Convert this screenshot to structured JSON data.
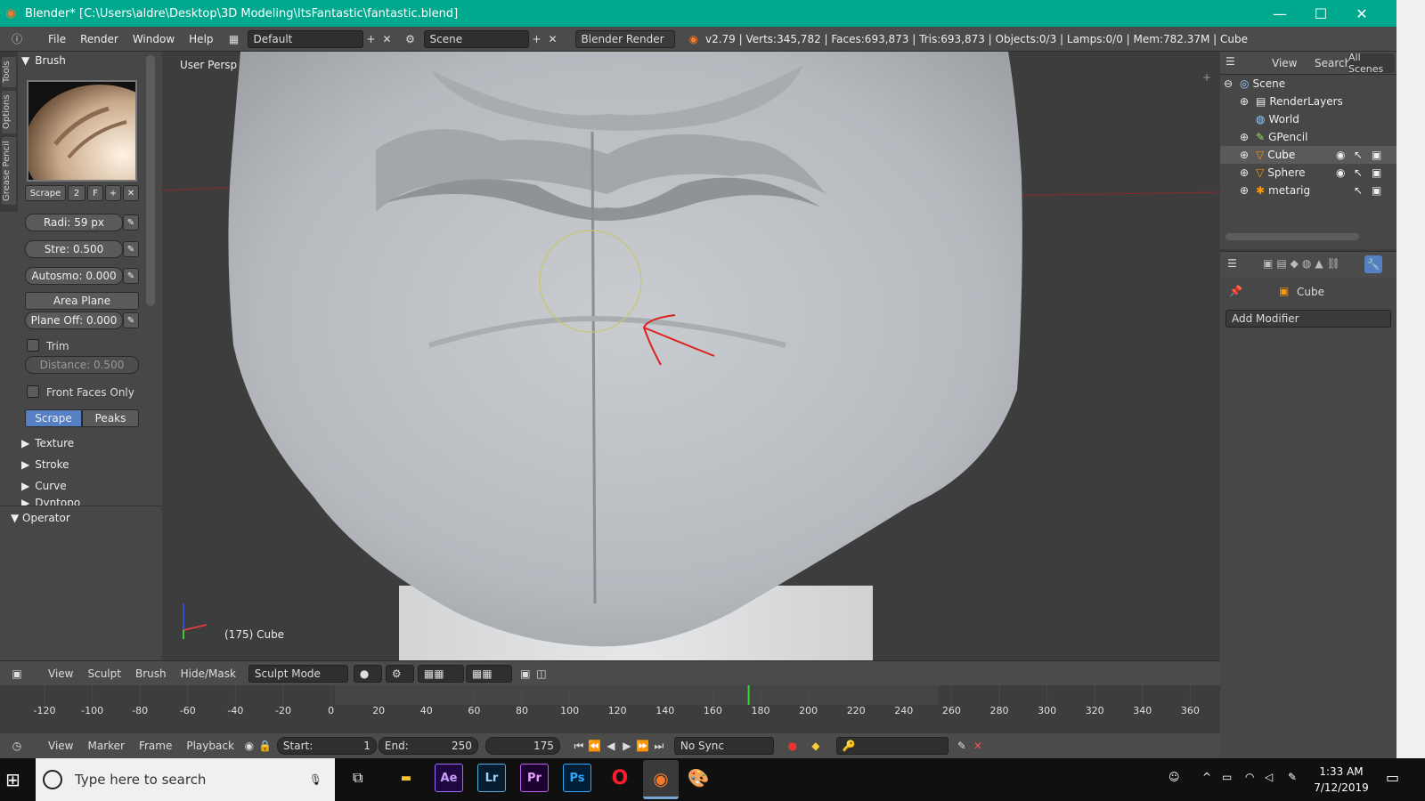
{
  "window": {
    "title": "Blender* [C:\\Users\\aldre\\Desktop\\3D Modeling\\ItsFantastic\\fantastic.blend]",
    "minimize": "—",
    "maximize": "☐",
    "close": "✕"
  },
  "menubar": {
    "items": [
      "File",
      "Render",
      "Window",
      "Help"
    ],
    "layout": "Default",
    "scene": "Scene",
    "engine": "Blender Render",
    "stats": "v2.79 | Verts:345,782 | Faces:693,873 | Tris:693,873 | Objects:0/3 | Lamps:0/0 | Mem:782.37M | Cube"
  },
  "tool_tabs": [
    "Tools",
    "Options",
    "Grease Pencil"
  ],
  "brush_panel": {
    "header": "Brush",
    "brush_name": "Scrape",
    "users": "2",
    "fake_user": "F",
    "radius_label": "Radi:",
    "radius_value": "59 px",
    "strength_label": "Stre:",
    "strength_value": "0.500",
    "autosmooth_label": "Autosmo:",
    "autosmooth_value": "0.000",
    "area_plane": "Area Plane",
    "plane_offset_label": "Plane Off:",
    "plane_offset_value": "0.000",
    "trim_label": "Trim",
    "trim_checked": false,
    "distance_label": "Distance:",
    "distance_value": "0.500",
    "front_faces_label": "Front Faces Only",
    "front_faces_checked": false,
    "mode_scrape": "Scrape",
    "mode_peaks": "Peaks",
    "active_mode": "Scrape",
    "collapsed": [
      "Texture",
      "Stroke",
      "Curve",
      "Dyntopo"
    ]
  },
  "operator_panel": {
    "header": "Operator"
  },
  "viewport": {
    "view_name": "User Persp",
    "object_info": "(175) Cube"
  },
  "outliner": {
    "view_label": "View",
    "search_label": "Search",
    "scenes_label": "All Scenes",
    "rows": [
      {
        "name": "Scene",
        "indent": 0
      },
      {
        "name": "RenderLayers",
        "indent": 1
      },
      {
        "name": "World",
        "indent": 1
      },
      {
        "name": "GPencil",
        "indent": 1
      },
      {
        "name": "Cube",
        "indent": 1
      },
      {
        "name": "Sphere",
        "indent": 1
      },
      {
        "name": "metarig",
        "indent": 1
      }
    ]
  },
  "properties": {
    "object_name": "Cube",
    "add_modifier": "Add Modifier"
  },
  "viewport_header": {
    "items": [
      "View",
      "Sculpt",
      "Brush",
      "Hide/Mask"
    ],
    "mode": "Sculpt Mode"
  },
  "timeline": {
    "ticks": [
      "-120",
      "-100",
      "-80",
      "-60",
      "-40",
      "-20",
      "0",
      "20",
      "40",
      "60",
      "80",
      "100",
      "120",
      "140",
      "160",
      "180",
      "200",
      "220",
      "240",
      "260",
      "280",
      "300",
      "320",
      "340",
      "360"
    ],
    "current_frame_value": 175,
    "menus": [
      "View",
      "Marker",
      "Frame",
      "Playback"
    ],
    "start_label": "Start:",
    "start_value": "1",
    "end_label": "End:",
    "end_value": "250",
    "current_frame": "175",
    "sync": "No Sync"
  },
  "taskbar": {
    "search_placeholder": "Type here to search",
    "apps": [
      "Ae",
      "Lr",
      "Pr",
      "Ps"
    ],
    "time": "1:33 AM",
    "date": "7/12/2019"
  },
  "colors": {
    "titlebar": "#00a88e",
    "active_button": "#5680c2",
    "annotation_arrow": "#e02020"
  }
}
